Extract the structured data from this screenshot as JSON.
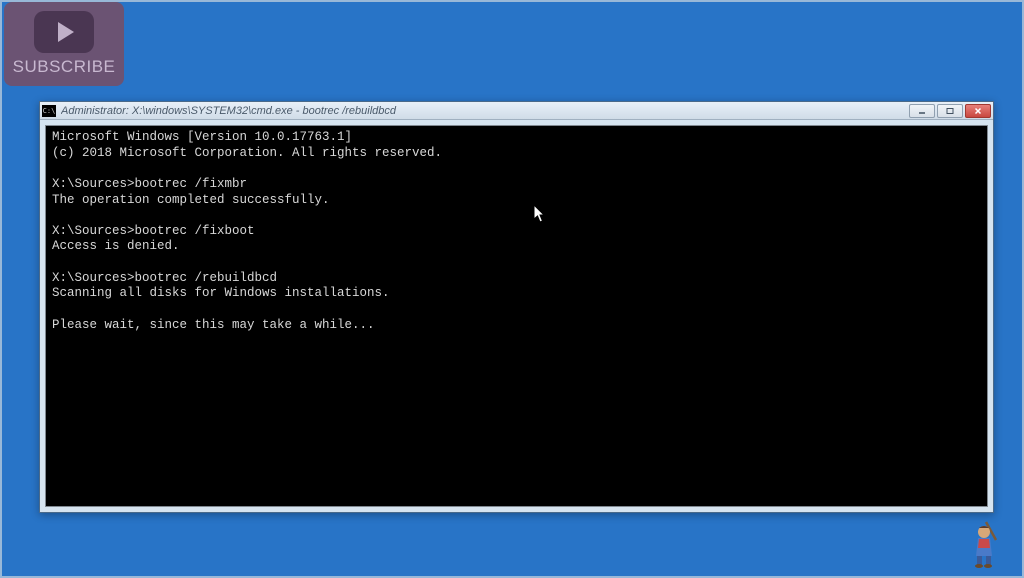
{
  "subscribe": {
    "label": "SUBSCRIBE"
  },
  "window": {
    "title": "Administrator: X:\\windows\\SYSTEM32\\cmd.exe - bootrec  /rebuildbcd"
  },
  "terminal_lines": {
    "l0": "Microsoft Windows [Version 10.0.17763.1]",
    "l1": "(c) 2018 Microsoft Corporation. All rights reserved.",
    "l2": "",
    "l3": "X:\\Sources>bootrec /fixmbr",
    "l4": "The operation completed successfully.",
    "l5": "",
    "l6": "X:\\Sources>bootrec /fixboot",
    "l7": "Access is denied.",
    "l8": "",
    "l9": "X:\\Sources>bootrec /rebuildbcd",
    "l10": "Scanning all disks for Windows installations.",
    "l11": "",
    "l12": "Please wait, since this may take a while..."
  }
}
